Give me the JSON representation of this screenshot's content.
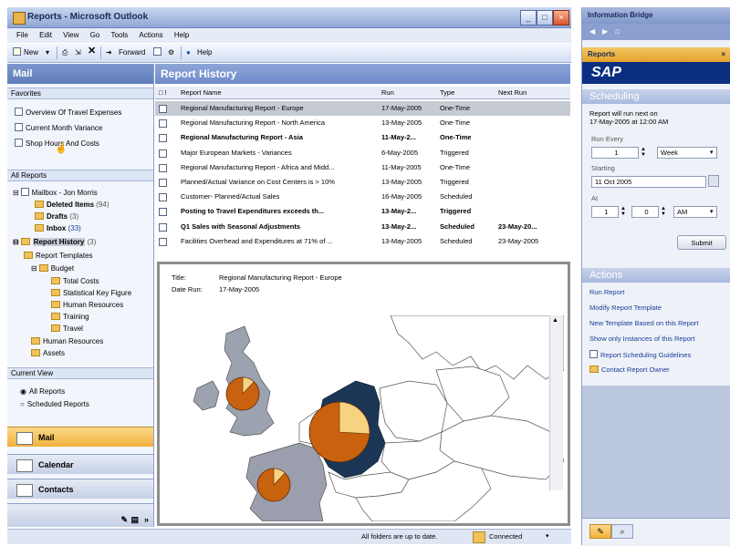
{
  "window": {
    "title": "Reports - Microsoft Outlook",
    "min": "_",
    "max": "□",
    "close": "×"
  },
  "menu": [
    "File",
    "Edit",
    "View",
    "Go",
    "Tools",
    "Actions",
    "Help"
  ],
  "toolbar": {
    "new": "New",
    "forward": "Forward",
    "help": "Help"
  },
  "nav": {
    "header": "Mail",
    "favorites_header": "Favorites",
    "favorites": [
      "Overview Of Travel Expenses",
      "Current Month Variance",
      "Shop Hours And Costs"
    ],
    "all_reports_header": "All Reports",
    "tree": [
      {
        "label": "Mailbox - Jon Morris"
      },
      {
        "label": "Deleted Items",
        "count": "(94)"
      },
      {
        "label": "Drafts",
        "count": "(3)"
      },
      {
        "label": "Inbox",
        "count": "(33)"
      },
      {
        "label": "Report History",
        "count": "(3)"
      },
      {
        "label": "Report Templates"
      },
      {
        "label": "Budget"
      },
      {
        "label": "Total Costs"
      },
      {
        "label": "Statistical Key Figure"
      },
      {
        "label": "Human Resources"
      },
      {
        "label": "Training"
      },
      {
        "label": "Travel"
      },
      {
        "label": "Human Resources"
      },
      {
        "label": "Assets"
      }
    ],
    "current_view_header": "Current View",
    "views": [
      "All Reports",
      "Scheduled Reports"
    ],
    "buttons": [
      "Mail",
      "Calendar",
      "Contacts"
    ]
  },
  "main": {
    "title": "Report History",
    "columns": [
      "Report Name",
      "Run",
      "Type",
      "Next Run"
    ],
    "rows": [
      {
        "name": "Regional Manufacturing Report - Europe",
        "run": "17-May-2005",
        "type": "One-Time",
        "next": "",
        "bold": false,
        "selected": true
      },
      {
        "name": "Regional Manufacturing Report - North America",
        "run": "13-May-2005",
        "type": "One-Time",
        "next": "",
        "bold": false
      },
      {
        "name": "Regional Manufacturing Report - Asia",
        "run": "11-May-2...",
        "type": "One-Time",
        "next": "",
        "bold": true
      },
      {
        "name": "Major European Markets - Variances",
        "run": "6-May-2005",
        "type": "Triggered",
        "next": "",
        "bold": false
      },
      {
        "name": "Regional Manufacturing Report - Africa and Midd...",
        "run": "11-May-2005",
        "type": "One-Time",
        "next": "",
        "bold": false
      },
      {
        "name": "Planned/Actual Variance on Cost Centers is > 10%",
        "run": "13-May-2005",
        "type": "Triggered",
        "next": "",
        "bold": false
      },
      {
        "name": "Customer- Planned/Actual Sales",
        "run": "16-May-2005",
        "type": "Scheduled",
        "next": "",
        "bold": false
      },
      {
        "name": "Posting to Travel Expenditures exceeds th...",
        "run": "13-May-2...",
        "type": "Triggered",
        "next": "",
        "bold": true
      },
      {
        "name": "Q1 Sales with Seasonal Adjustments",
        "run": "13-May-2...",
        "type": "Scheduled",
        "next": "23-May-20...",
        "bold": true
      },
      {
        "name": "Facilities Overhead and Expenditures at 71% of ...",
        "run": "13-May-2005",
        "type": "Scheduled",
        "next": "23-May-2005",
        "bold": false
      }
    ]
  },
  "preview": {
    "title_label": "Title:",
    "title_value": "Regional Manufacturing Report - Europe",
    "date_label": "Date Run:",
    "date_value": "17-May-2005"
  },
  "status": {
    "text": "All folders are up to date.",
    "connection": "Connected"
  },
  "right": {
    "title": "Information Bridge",
    "reports_label": "Reports",
    "brand": "SAP",
    "scheduling_header": "Scheduling",
    "next_run_text1": "Report will run next on",
    "next_run_text2": "17-May-2005 at 12:00 AM",
    "run_every_label": "Run Every",
    "run_every_value": "1",
    "period_value": "Week",
    "starting_label": "Starting",
    "starting_value": "11 Oct 2005",
    "at_label": "At",
    "hour_value": "1",
    "minute_value": "0",
    "ampm_value": "AM",
    "submit_label": "Submit",
    "actions_header": "Actions",
    "actions": [
      "Run Report",
      "Modify Report Template",
      "New Template Based on this Report",
      "Show only Instances of this Report",
      "Report Scheduling Guidelines",
      "Contact Report Owner"
    ]
  },
  "colors": {
    "accent": "#6e8acb",
    "pie_orange": "#c9620e",
    "pie_yellow": "#f6d281",
    "germany": "#1c3656",
    "france": "#9b9fad",
    "uk": "#9da2b1"
  }
}
